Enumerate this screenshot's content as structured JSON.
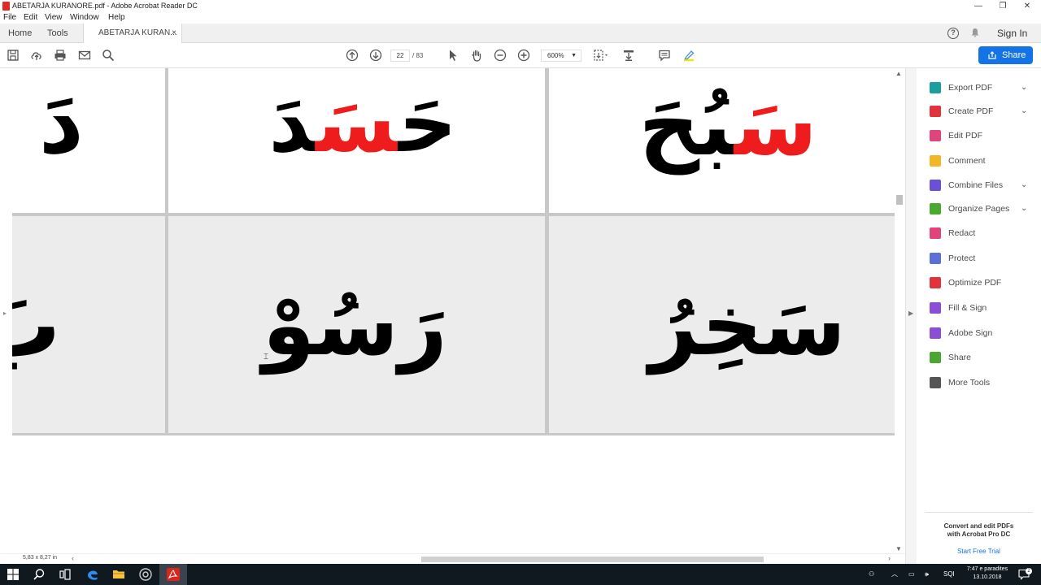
{
  "window": {
    "title": "ABETARJA KURANORE.pdf - Adobe Acrobat Reader DC",
    "controls": [
      "minimize",
      "restore",
      "close"
    ]
  },
  "menu": [
    "File",
    "Edit",
    "View",
    "Window",
    "Help"
  ],
  "tabs": {
    "home": "Home",
    "tools": "Tools",
    "document": "ABETARJA KURAN...",
    "close": "×",
    "sign_in": "Sign In",
    "help": "?"
  },
  "toolbar": {
    "page_current": "22",
    "page_total": "/ 83",
    "zoom": "600%",
    "share": "Share"
  },
  "document": {
    "cells": [
      {
        "text": "دَ",
        "red": ""
      },
      {
        "text_black_right": "حَ",
        "text_red": "سَ",
        "text_black_left": "دَ"
      },
      {
        "text_black_left": "بُحَ",
        "text_red": "سَ"
      },
      {
        "text": "بَ"
      },
      {
        "text": "رَسُوْ"
      },
      {
        "text": "سَخِرُ"
      }
    ],
    "page_size": "5,83 x 8,27 in"
  },
  "right_panel": {
    "items": [
      {
        "label": "Export PDF",
        "icon": "export-pdf-icon",
        "color": "#1a9e9e",
        "has_chevron": true
      },
      {
        "label": "Create PDF",
        "icon": "create-pdf-icon",
        "color": "#e0333b",
        "has_chevron": true
      },
      {
        "label": "Edit PDF",
        "icon": "edit-pdf-icon",
        "color": "#e0447a",
        "has_chevron": false
      },
      {
        "label": "Comment",
        "icon": "comment-icon",
        "color": "#f2b724",
        "has_chevron": false
      },
      {
        "label": "Combine Files",
        "icon": "combine-files-icon",
        "color": "#6b4fd6",
        "has_chevron": true
      },
      {
        "label": "Organize Pages",
        "icon": "organize-pages-icon",
        "color": "#4aa832",
        "has_chevron": true
      },
      {
        "label": "Redact",
        "icon": "redact-icon",
        "color": "#e0447a",
        "has_chevron": false
      },
      {
        "label": "Protect",
        "icon": "protect-icon",
        "color": "#5b6fd6",
        "has_chevron": false
      },
      {
        "label": "Optimize PDF",
        "icon": "optimize-pdf-icon",
        "color": "#e0333b",
        "has_chevron": false
      },
      {
        "label": "Fill & Sign",
        "icon": "fill-sign-icon",
        "color": "#8a4fd6",
        "has_chevron": false
      },
      {
        "label": "Adobe Sign",
        "icon": "adobe-sign-icon",
        "color": "#8a4fd6",
        "has_chevron": false
      },
      {
        "label": "Share",
        "icon": "share-icon",
        "color": "#4aa832",
        "has_chevron": false
      },
      {
        "label": "More Tools",
        "icon": "more-tools-icon",
        "color": "#555555",
        "has_chevron": false
      }
    ],
    "promo_line1": "Convert and edit PDFs",
    "promo_line2": "with Acrobat Pro DC",
    "promo_link": "Start Free Trial"
  },
  "taskbar": {
    "language": "SQI",
    "time": "7:47 e paradites",
    "date": "13.10.2018",
    "notifications": "2"
  }
}
